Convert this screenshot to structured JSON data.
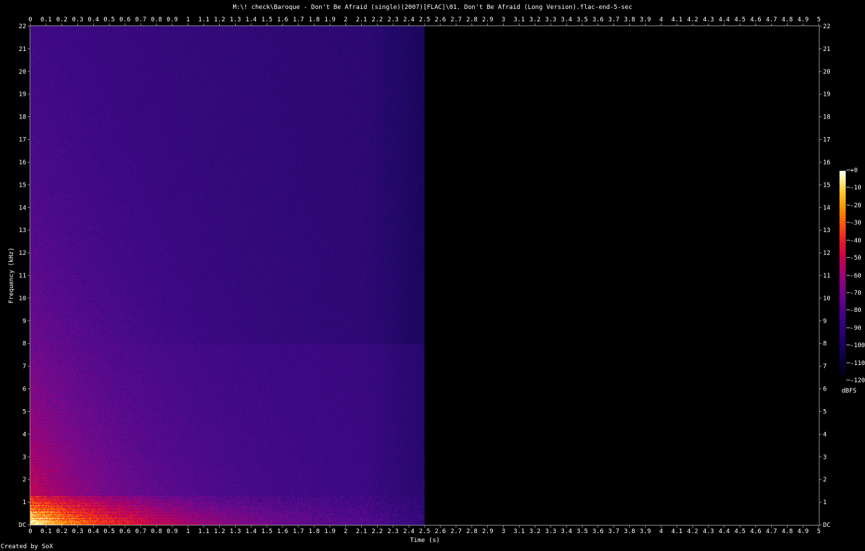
{
  "chart_data": {
    "type": "heatmap",
    "title": "M:\\! check\\Baroque - Don't Be Afraid (single)(2007)[FLAC]\\01. Don't Be Afraid (Long Version).flac-end-5-sec",
    "xlabel": "Time (s)",
    "ylabel": "Frequency (kHz)",
    "xlim": [
      0,
      5
    ],
    "ylim": [
      0,
      22
    ],
    "x_ticks": [
      "0",
      "0.1",
      "0.2",
      "0.3",
      "0.4",
      "0.5",
      "0.6",
      "0.7",
      "0.8",
      "0.9",
      "1",
      "1.1",
      "1.2",
      "1.3",
      "1.4",
      "1.5",
      "1.6",
      "1.7",
      "1.8",
      "1.9",
      "2",
      "2.1",
      "2.2",
      "2.3",
      "2.4",
      "2.5",
      "2.6",
      "2.7",
      "2.8",
      "2.9",
      "3",
      "3.1",
      "3.2",
      "3.3",
      "3.4",
      "3.5",
      "3.6",
      "3.7",
      "3.8",
      "3.9",
      "4",
      "4.1",
      "4.2",
      "4.3",
      "4.4",
      "4.5",
      "4.6",
      "4.7",
      "4.8",
      "4.9",
      "5"
    ],
    "y_ticks": [
      "DC",
      "1",
      "2",
      "3",
      "4",
      "5",
      "6",
      "7",
      "8",
      "9",
      "10",
      "11",
      "12",
      "13",
      "14",
      "15",
      "16",
      "17",
      "18",
      "19",
      "20",
      "21",
      "22"
    ],
    "colorbar": {
      "unit": "dBFS",
      "range": [
        -120,
        0
      ],
      "ticks": [
        "+0",
        "-10",
        "-20",
        "-30",
        "-40",
        "-50",
        "-60",
        "-70",
        "-80",
        "-90",
        "-100",
        "-110",
        "-120"
      ]
    },
    "signal_end_time_s": 2.5,
    "colors": {
      "background": "#000000",
      "noise_floor": "#1a0a5a",
      "mid": "#8a1080",
      "hot": "#ff2010",
      "peak": "#ffe070"
    }
  },
  "footer": "Created by SoX"
}
